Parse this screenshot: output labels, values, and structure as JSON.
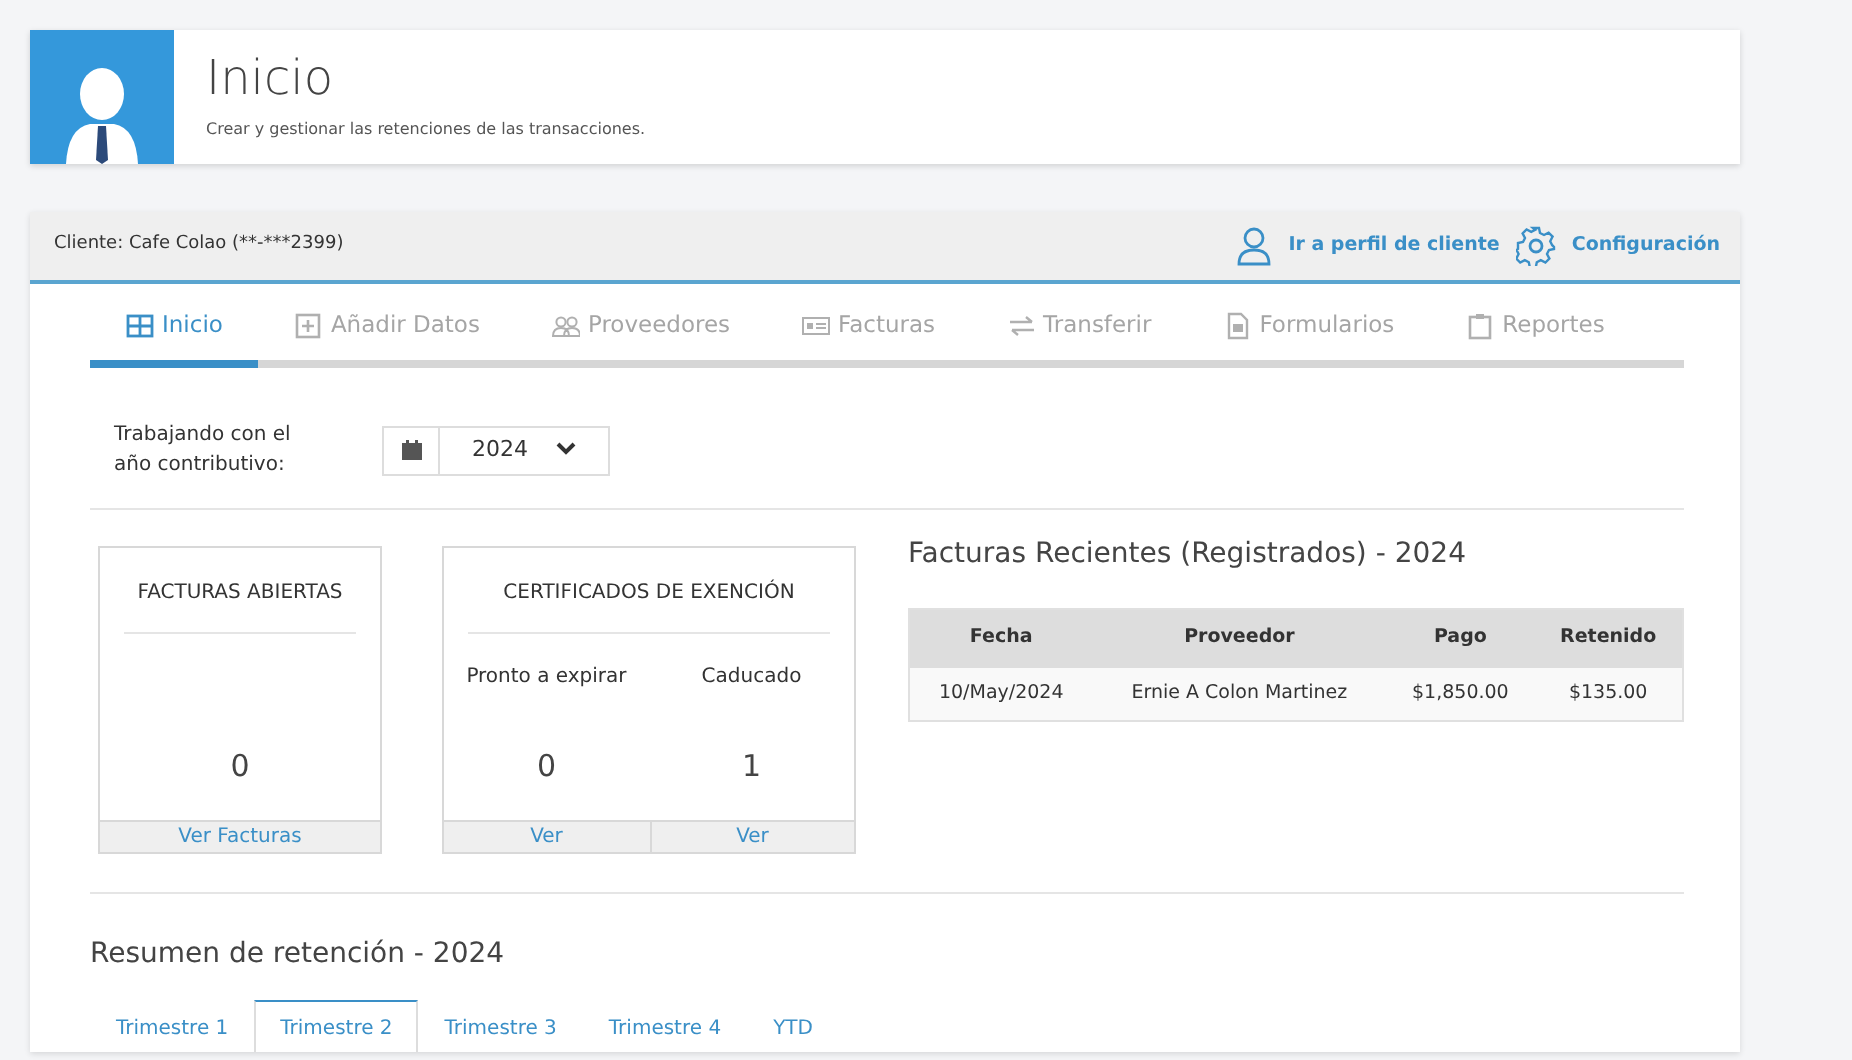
{
  "header": {
    "title": "Inicio",
    "subtitle": "Crear y gestionar las retenciones de las transacciones."
  },
  "client_bar": {
    "client": "Cliente: Cafe Colao (**-***2399)",
    "links": [
      "Ir a perfil de cliente",
      "Configuración"
    ]
  },
  "tabs": [
    {
      "label": "Inicio",
      "selected": true
    },
    {
      "label": "Añadir Datos",
      "selected": false
    },
    {
      "label": "Proveedores",
      "selected": false
    },
    {
      "label": "Facturas",
      "selected": false
    },
    {
      "label": "Transferir",
      "selected": false
    },
    {
      "label": "Formularios",
      "selected": false
    },
    {
      "label": "Reportes",
      "selected": false
    }
  ],
  "tax_year": {
    "label": "Trabajando con el año contributivo:",
    "value": "2024"
  },
  "open_invoices": {
    "title": "FACTURAS ABIERTAS",
    "count": "0",
    "link": "Ver Facturas"
  },
  "certificates": {
    "title": "CERTIFICADOS DE EXENCIÓN",
    "columns": [
      {
        "label": "Pronto a expirar",
        "count": "0",
        "link": "Ver"
      },
      {
        "label": "Caducado",
        "count": "1",
        "link": "Ver"
      }
    ]
  },
  "recent_invoices": {
    "title": "Facturas Recientes (Registrados) - 2024",
    "columns": [
      "Fecha",
      "Proveedor",
      "Pago",
      "Retenido"
    ],
    "rows": [
      [
        "10/May/2024",
        "Ernie A Colon Martinez",
        "$1,850.00",
        "$135.00"
      ]
    ]
  },
  "summary": {
    "title": "Resumen de retención - 2024",
    "tabs": [
      {
        "label": "Trimestre 1",
        "selected": false
      },
      {
        "label": "Trimestre 2",
        "selected": true
      },
      {
        "label": "Trimestre 3",
        "selected": false
      },
      {
        "label": "Trimestre 4",
        "selected": false
      },
      {
        "label": "YTD",
        "selected": false
      }
    ]
  }
}
